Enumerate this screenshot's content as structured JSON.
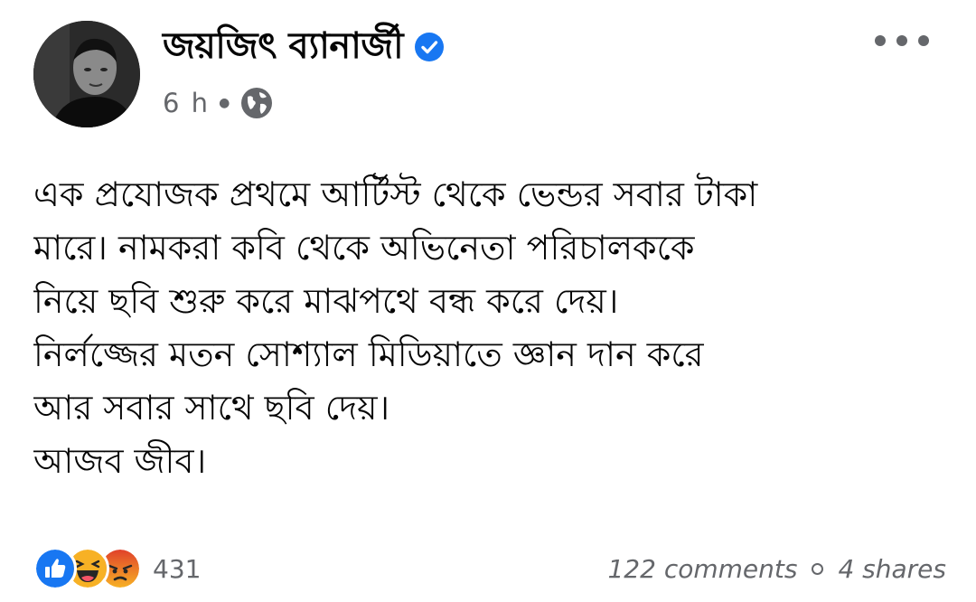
{
  "post": {
    "author": "জয়জিৎ ব্যানার্জী",
    "verified": true,
    "time": "6 h",
    "audience_icon": "globe-icon",
    "more_icon": "more-dots-icon",
    "body_lines": [
      "এক প্রযোজক প্রথমে আর্টিস্ট থেকে ভেন্ডর সবার টাকা",
      "মারে। নামকরা কবি থেকে অভিনেতা  পরিচালককে",
      "নিয়ে ছবি শুরু করে মাঝপথে বন্ধ করে দেয়।",
      "নির্লজ্জের মতন সোশ্যাল মিডিয়াতে জ্ঞান দান করে",
      "আর সবার সাথে ছবি দেয়।",
      "আজব জীব।"
    ],
    "reactions": [
      "like-icon",
      "haha-icon",
      "angry-icon"
    ],
    "reaction_count": "431",
    "comments": "122 comments",
    "shares": "4 shares"
  },
  "colors": {
    "text": "#050505",
    "secondary": "#65676b",
    "verified_blue": "#1877f2",
    "like_blue": "#1877f2",
    "haha_yellow": "#f7b125",
    "angry_orange": "#e9710f"
  }
}
